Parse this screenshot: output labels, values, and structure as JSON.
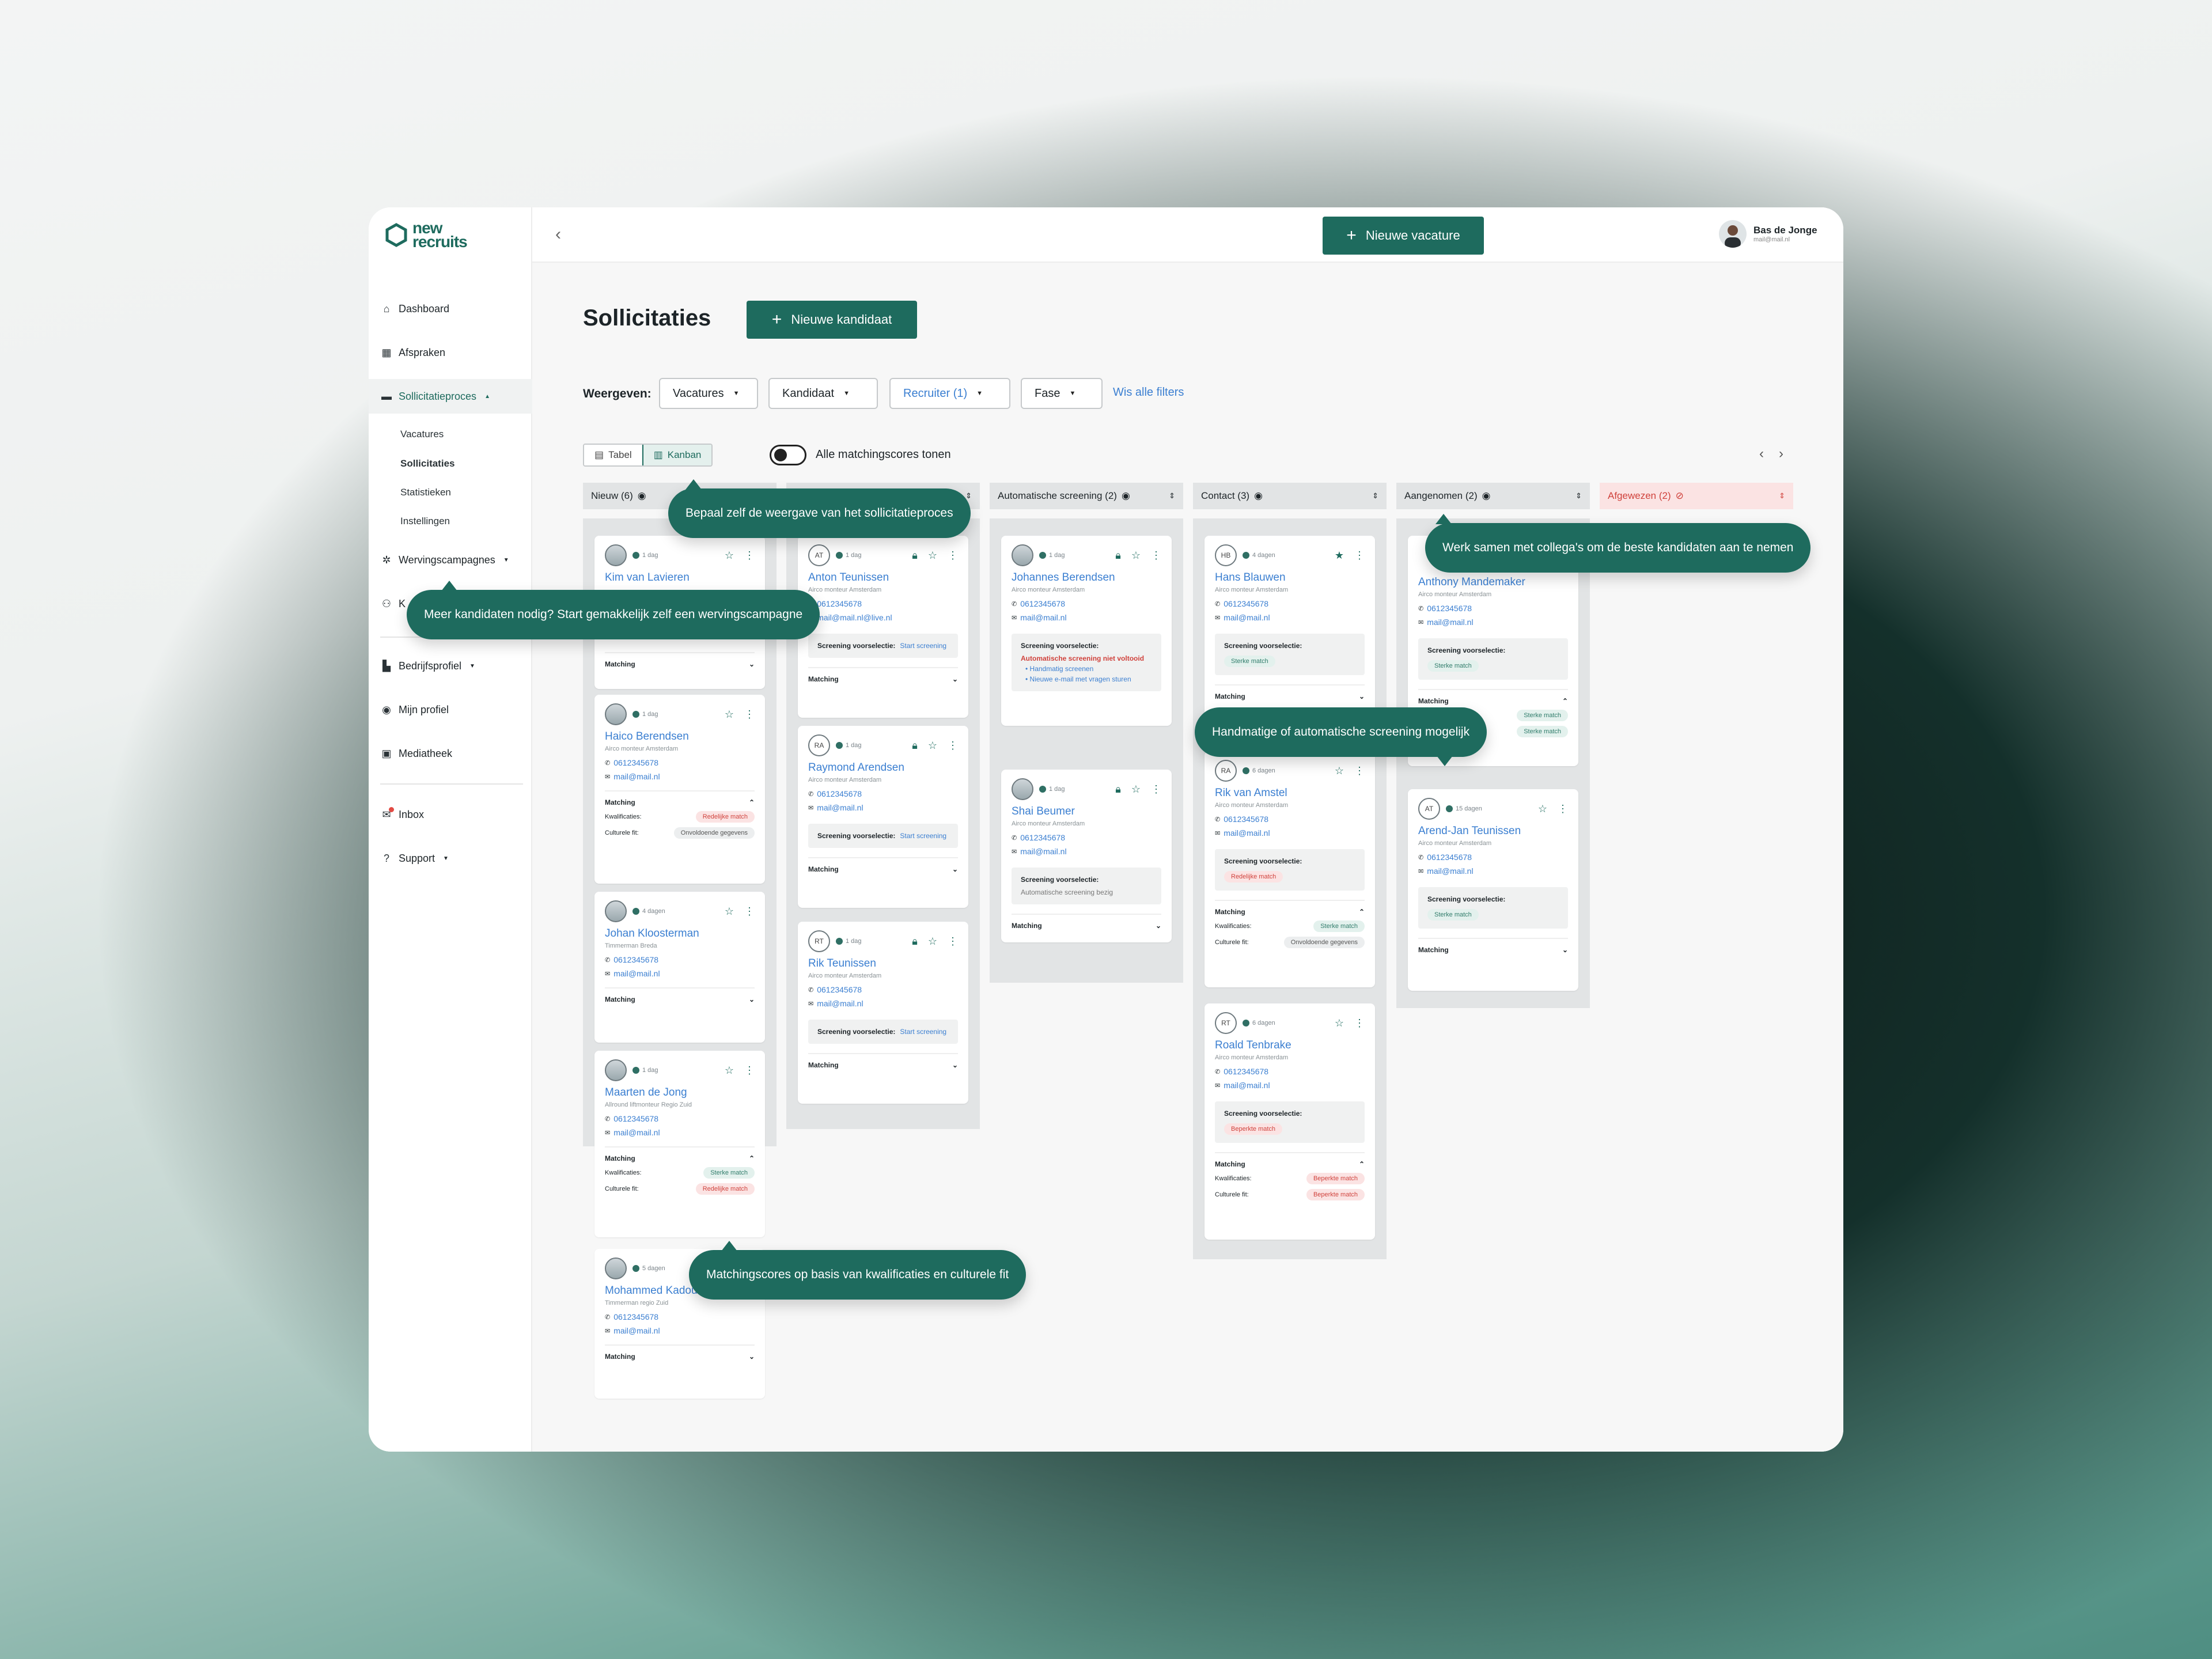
{
  "app": {
    "logo_line1": "new",
    "logo_line2": "recruits"
  },
  "sidebar": {
    "items": [
      {
        "label": "Dashboard",
        "icon": "home-icon"
      },
      {
        "label": "Afspraken",
        "icon": "calendar-icon"
      },
      {
        "label": "Sollicitatieproces",
        "icon": "briefcase-icon"
      },
      {
        "label": "Wervingscampagnes",
        "icon": "network-icon"
      },
      {
        "label": "Bedrijfsprofiel",
        "icon": "building-icon"
      },
      {
        "label": "Mijn profiel",
        "icon": "user-circle-icon"
      },
      {
        "label": "Mediatheek",
        "icon": "image-icon"
      },
      {
        "label": "Inbox",
        "icon": "mail-icon"
      },
      {
        "label": "Support",
        "icon": "help-icon"
      }
    ],
    "subitems": [
      "Vacatures",
      "Sollicitaties",
      "Statistieken",
      "Instellingen"
    ],
    "hidden_item_partial": "K"
  },
  "topbar": {
    "new_vacancy": "Nieuwe vacature",
    "user_name": "Bas de Jonge",
    "user_email": "mail@mail.nl"
  },
  "page": {
    "title": "Sollicitaties",
    "new_candidate": "Nieuwe kandidaat"
  },
  "filters": {
    "label": "Weergeven:",
    "vacatures": "Vacatures",
    "kandidaat": "Kandidaat",
    "recruiter": "Recruiter (1)",
    "fase": "Fase",
    "clear": "Wis alle filters"
  },
  "view": {
    "tabel": "Tabel",
    "kanban": "Kanban",
    "toggle_label": "Alle matchingscores tonen"
  },
  "columns": [
    {
      "title": "Nieuw (6)"
    },
    {
      "title": ""
    },
    {
      "title": "Automatische screening (2)"
    },
    {
      "title": "Contact (3)"
    },
    {
      "title": "Aangenomen (2)"
    },
    {
      "title": "Afgewezen (2)"
    }
  ],
  "labels": {
    "matching": "Matching",
    "kwal": "Kwalificaties:",
    "cult": "Culturele fit:",
    "scr": "Screening voorselectie:",
    "start": "Start screening"
  },
  "cards": {
    "c1": {
      "time": "1 dag",
      "name": "Kim van Lavieren"
    },
    "c2": {
      "time": "1 dag",
      "name": "Haico Berendsen",
      "job": "Airco monteur Amsterdam",
      "phone": "0612345678",
      "mail": "mail@mail.nl",
      "kw": "Redelijke match",
      "cf": "Onvoldoende gegevens"
    },
    "c3": {
      "time": "4 dagen",
      "name": "Johan Kloosterman",
      "job": "Timmerman Breda",
      "phone": "0612345678",
      "mail": "mail@mail.nl"
    },
    "c4": {
      "time": "1 dag",
      "name": "Maarten de Jong",
      "job": "Allround liftmonteur Regio Zuid",
      "phone": "0612345678",
      "mail": "mail@mail.nl",
      "kw": "Sterke match",
      "cf": "Redelijke match"
    },
    "c5": {
      "time": "5 dagen",
      "name": "Mohammed Kadoun",
      "job": "Timmerman regio Zuid",
      "phone": "0612345678",
      "mail": "mail@mail.nl"
    },
    "d1": {
      "init": "AT",
      "time": "1 dag",
      "name": "Anton Teunissen",
      "job": "Airco monteur Amsterdam",
      "phone": "0612345678",
      "mail": "mail@mail.nl@live.nl"
    },
    "d2": {
      "init": "RA",
      "time": "1 dag",
      "name": "Raymond Arendsen",
      "job": "Airco monteur Amsterdam",
      "phone": "0612345678",
      "mail": "mail@mail.nl"
    },
    "d3": {
      "init": "RT",
      "time": "1 dag",
      "name": "Rik Teunissen",
      "job": "Airco monteur Amsterdam",
      "phone": "0612345678",
      "mail": "mail@mail.nl"
    },
    "e1": {
      "time": "1 dag",
      "name": "Johannes Berendsen",
      "job": "Airco monteur Amsterdam",
      "phone": "0612345678",
      "mail": "mail@mail.nl",
      "warn": "Automatische screening niet voltooid",
      "b1": "Handmatig screenen",
      "b2": "Nieuwe e-mail met vragen sturen"
    },
    "e2": {
      "time": "1 dag",
      "name": "Shai Beumer",
      "job": "Airco monteur Amsterdam",
      "phone": "0612345678",
      "mail": "mail@mail.nl",
      "status": "Automatische screening bezig"
    },
    "f1": {
      "init": "HB",
      "time": "4 dagen",
      "name": "Hans Blauwen",
      "job": "Airco monteur Amsterdam",
      "phone": "0612345678",
      "mail": "mail@mail.nl",
      "tag": "Sterke match"
    },
    "f2": {
      "init": "RA",
      "time": "6 dagen",
      "name": "Rik van Amstel",
      "job": "Airco monteur Amsterdam",
      "phone": "0612345678",
      "mail": "mail@mail.nl",
      "tag": "Redelijke match",
      "kw": "Sterke match",
      "cf": "Onvoldoende gegevens"
    },
    "f3": {
      "init": "RT",
      "time": "6 dagen",
      "name": "Roald Tenbrake",
      "job": "Airco monteur Amsterdam",
      "phone": "0612345678",
      "mail": "mail@mail.nl",
      "tag": "Beperkte match",
      "kw": "Beperkte match",
      "cf": "Beperkte match"
    },
    "g1": {
      "name": "Anthony Mandemaker",
      "job": "Airco monteur Amsterdam",
      "phone": "0612345678",
      "mail": "mail@mail.nl",
      "tag": "Sterke match",
      "kw": "Sterke match",
      "cf": "Sterke match"
    },
    "g2": {
      "init": "AT",
      "time": "15 dagen",
      "name": "Arend-Jan Teunissen",
      "job": "Airco monteur Amsterdam",
      "phone": "0612345678",
      "mail": "mail@mail.nl",
      "tag": "Sterke match"
    }
  },
  "tooltips": {
    "view": "Bepaal zelf de weergave van het sollicitatieproces",
    "campaign": "Meer kandidaten nodig? Start gemakkelijk zelf een wervingscampagne",
    "collab": "Werk samen met collega's om de beste kandidaten aan te nemen",
    "screening": "Handmatige of automatische screening mogelijk",
    "matching": "Matchingscores op basis van kwalificaties en culturele fit"
  },
  "colors": {
    "brand": "#1e6b5e",
    "link": "#3b7fd1",
    "danger": "#d0423c"
  }
}
